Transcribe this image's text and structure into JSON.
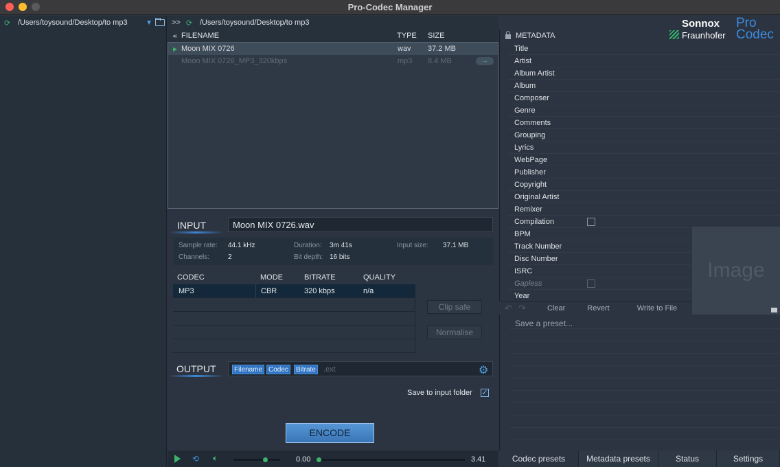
{
  "window": {
    "title": "Pro-Codec Manager"
  },
  "left_panel": {
    "path": "/Users/toysound/Desktop/to mp3"
  },
  "browser": {
    "nav_chevrons": ">>",
    "path": "/Users/toysound/Desktop/to mp3",
    "columns": {
      "filename": "FILENAME",
      "type": "TYPE",
      "size": "SIZE"
    },
    "files": [
      {
        "name": "Moon MIX 0726",
        "type": "wav",
        "size": "37.2 MB",
        "selected": true
      },
      {
        "name": "Moon MIX 0726_MP3_320kbps",
        "type": "mp3",
        "size": "8.4 MB",
        "selected": false
      }
    ]
  },
  "input": {
    "label": "INPUT",
    "filename": "Moon MIX 0726.wav",
    "sample_rate_label": "Sample rate:",
    "sample_rate": "44.1 kHz",
    "channels_label": "Channels:",
    "channels": "2",
    "duration_label": "Duration:",
    "duration": "3m 41s",
    "bit_depth_label": "Bit depth:",
    "bit_depth": "16 bits",
    "input_size_label": "Input size:",
    "input_size": "37.1 MB"
  },
  "codec": {
    "columns": {
      "codec": "CODEC",
      "mode": "MODE",
      "bitrate": "BITRATE",
      "quality": "QUALITY"
    },
    "rows": [
      {
        "codec": "MP3",
        "mode": "CBR",
        "bitrate": "320 kbps",
        "quality": "n/a"
      }
    ],
    "clip_safe": "Clip safe",
    "normalise": "Normalise"
  },
  "output": {
    "label": "OUTPUT",
    "tokens": [
      "Filename",
      "Codec",
      "Bitrate"
    ],
    "ext": ".ext",
    "save_to_input_folder": "Save to input folder",
    "save_to_input_checked": true
  },
  "encode_label": "ENCODE",
  "transport": {
    "start": "0.00",
    "end": "3.41",
    "volume_level": 0.7,
    "position": 0.0
  },
  "metadata": {
    "header": "METADATA",
    "fields": [
      "Title",
      "Artist",
      "Album Artist",
      "Album",
      "Composer",
      "Genre",
      "Comments",
      "Grouping",
      "Lyrics",
      "WebPage",
      "Publisher",
      "Copyright",
      "Original Artist",
      "Remixer",
      "Compilation",
      "BPM",
      "Track Number",
      "Disc Number",
      "ISRC",
      "Gapless",
      "Year"
    ],
    "image_label": "Image",
    "toolbar": {
      "clear": "Clear",
      "revert": "Revert",
      "write": "Write to File"
    },
    "preset_placeholder": "Save a preset..."
  },
  "logo": {
    "sonnox": "Sonnox",
    "fraunhofer": "Fraunhofer",
    "pro": "Pro",
    "codec": "Codec"
  },
  "tabs": [
    "Codec presets",
    "Metadata presets",
    "Status",
    "Settings"
  ],
  "colors": {
    "accent": "#3d86d6",
    "green": "#3fb26c",
    "panel": "#2b3440"
  }
}
